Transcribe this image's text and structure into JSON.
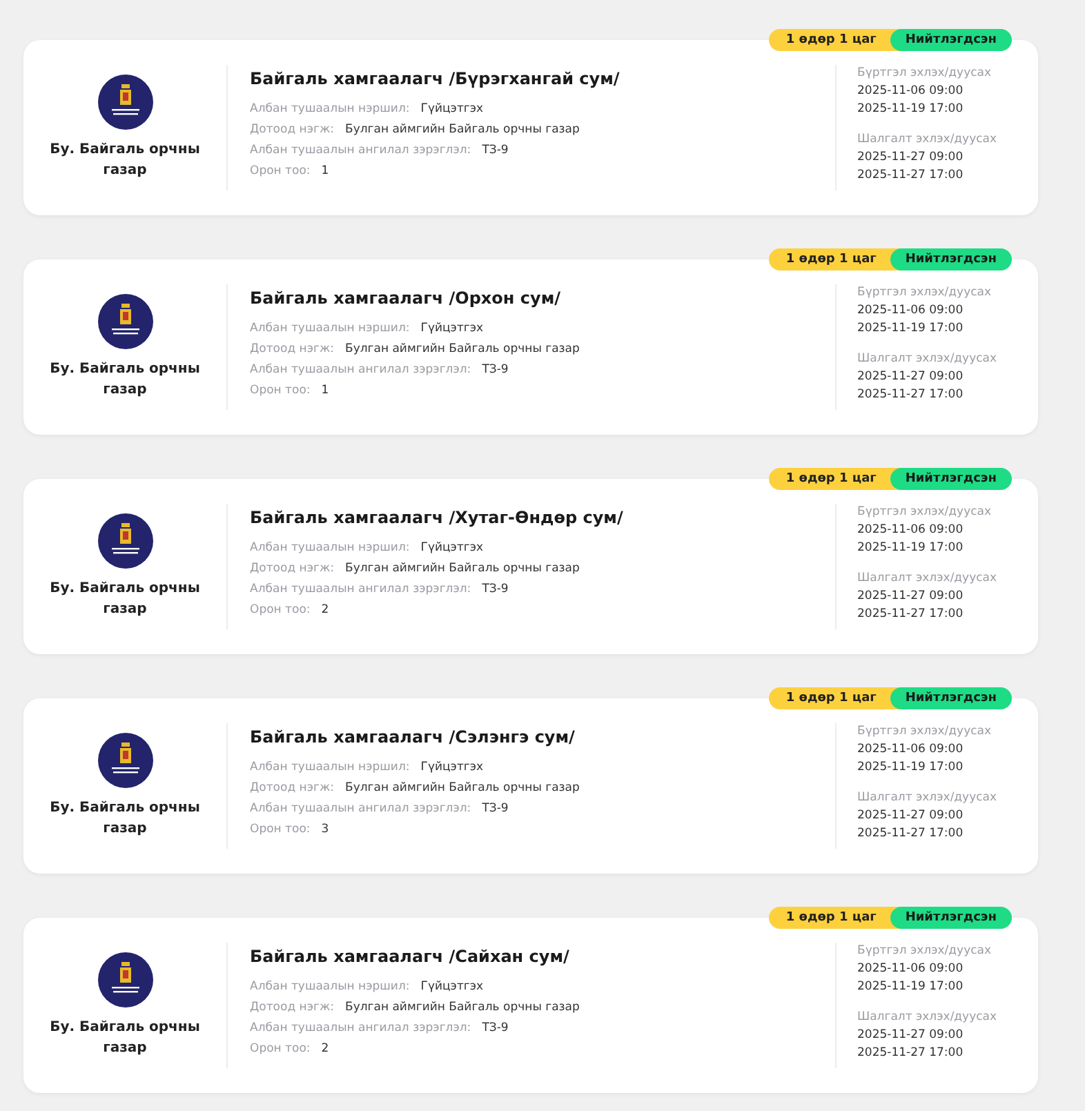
{
  "jobs": [
    {
      "duration": "1 өдөр 1 цаг",
      "status": "Нийтлэгдсэн",
      "org": "Бу. Байгаль орчны газар",
      "title": "Байгаль хамгаалагч /Бүрэгхангай сум/",
      "fields": [
        {
          "label": "Албан тушаалын нэршил:",
          "value": "Гүйцэтгэх"
        },
        {
          "label": "Дотоод нэгж:",
          "value": "Булган аймгийн Байгаль орчны газар"
        },
        {
          "label": "Албан тушаалын ангилал зэрэглэл:",
          "value": "ТЗ-9"
        },
        {
          "label": "Орон тоо:",
          "value": "1"
        }
      ],
      "dates": [
        {
          "label": "Бүртгэл эхлэх/дуусах",
          "start": "2025-11-06 09:00",
          "end": "2025-11-19 17:00"
        },
        {
          "label": "Шалгалт эхлэх/дуусах",
          "start": "2025-11-27 09:00",
          "end": "2025-11-27 17:00"
        }
      ]
    },
    {
      "duration": "1 өдөр 1 цаг",
      "status": "Нийтлэгдсэн",
      "org": "Бу. Байгаль орчны газар",
      "title": "Байгаль хамгаалагч /Орхон сум/",
      "fields": [
        {
          "label": "Албан тушаалын нэршил:",
          "value": "Гүйцэтгэх"
        },
        {
          "label": "Дотоод нэгж:",
          "value": "Булган аймгийн Байгаль орчны газар"
        },
        {
          "label": "Албан тушаалын ангилал зэрэглэл:",
          "value": "ТЗ-9"
        },
        {
          "label": "Орон тоо:",
          "value": "1"
        }
      ],
      "dates": [
        {
          "label": "Бүртгэл эхлэх/дуусах",
          "start": "2025-11-06 09:00",
          "end": "2025-11-19 17:00"
        },
        {
          "label": "Шалгалт эхлэх/дуусах",
          "start": "2025-11-27 09:00",
          "end": "2025-11-27 17:00"
        }
      ]
    },
    {
      "duration": "1 өдөр 1 цаг",
      "status": "Нийтлэгдсэн",
      "org": "Бу. Байгаль орчны газар",
      "title": "Байгаль хамгаалагч /Хутаг-Өндөр сум/",
      "fields": [
        {
          "label": "Албан тушаалын нэршил:",
          "value": "Гүйцэтгэх"
        },
        {
          "label": "Дотоод нэгж:",
          "value": "Булган аймгийн Байгаль орчны газар"
        },
        {
          "label": "Албан тушаалын ангилал зэрэглэл:",
          "value": "ТЗ-9"
        },
        {
          "label": "Орон тоо:",
          "value": "2"
        }
      ],
      "dates": [
        {
          "label": "Бүртгэл эхлэх/дуусах",
          "start": "2025-11-06 09:00",
          "end": "2025-11-19 17:00"
        },
        {
          "label": "Шалгалт эхлэх/дуусах",
          "start": "2025-11-27 09:00",
          "end": "2025-11-27 17:00"
        }
      ]
    },
    {
      "duration": "1 өдөр 1 цаг",
      "status": "Нийтлэгдсэн",
      "org": "Бу. Байгаль орчны газар",
      "title": "Байгаль хамгаалагч /Сэлэнгэ сум/",
      "fields": [
        {
          "label": "Албан тушаалын нэршил:",
          "value": "Гүйцэтгэх"
        },
        {
          "label": "Дотоод нэгж:",
          "value": "Булган аймгийн Байгаль орчны газар"
        },
        {
          "label": "Албан тушаалын ангилал зэрэглэл:",
          "value": "ТЗ-9"
        },
        {
          "label": "Орон тоо:",
          "value": "3"
        }
      ],
      "dates": [
        {
          "label": "Бүртгэл эхлэх/дуусах",
          "start": "2025-11-06 09:00",
          "end": "2025-11-19 17:00"
        },
        {
          "label": "Шалгалт эхлэх/дуусах",
          "start": "2025-11-27 09:00",
          "end": "2025-11-27 17:00"
        }
      ]
    },
    {
      "duration": "1 өдөр 1 цаг",
      "status": "Нийтлэгдсэн",
      "org": "Бу. Байгаль орчны газар",
      "title": "Байгаль хамгаалагч /Сайхан сум/",
      "fields": [
        {
          "label": "Албан тушаалын нэршил:",
          "value": "Гүйцэтгэх"
        },
        {
          "label": "Дотоод нэгж:",
          "value": "Булган аймгийн Байгаль орчны газар"
        },
        {
          "label": "Албан тушаалын ангилал зэрэглэл:",
          "value": "ТЗ-9"
        },
        {
          "label": "Орон тоо:",
          "value": "2"
        }
      ],
      "dates": [
        {
          "label": "Бүртгэл эхлэх/дуусах",
          "start": "2025-11-06 09:00",
          "end": "2025-11-19 17:00"
        },
        {
          "label": "Шалгалт эхлэх/дуусах",
          "start": "2025-11-27 09:00",
          "end": "2025-11-27 17:00"
        }
      ]
    }
  ]
}
